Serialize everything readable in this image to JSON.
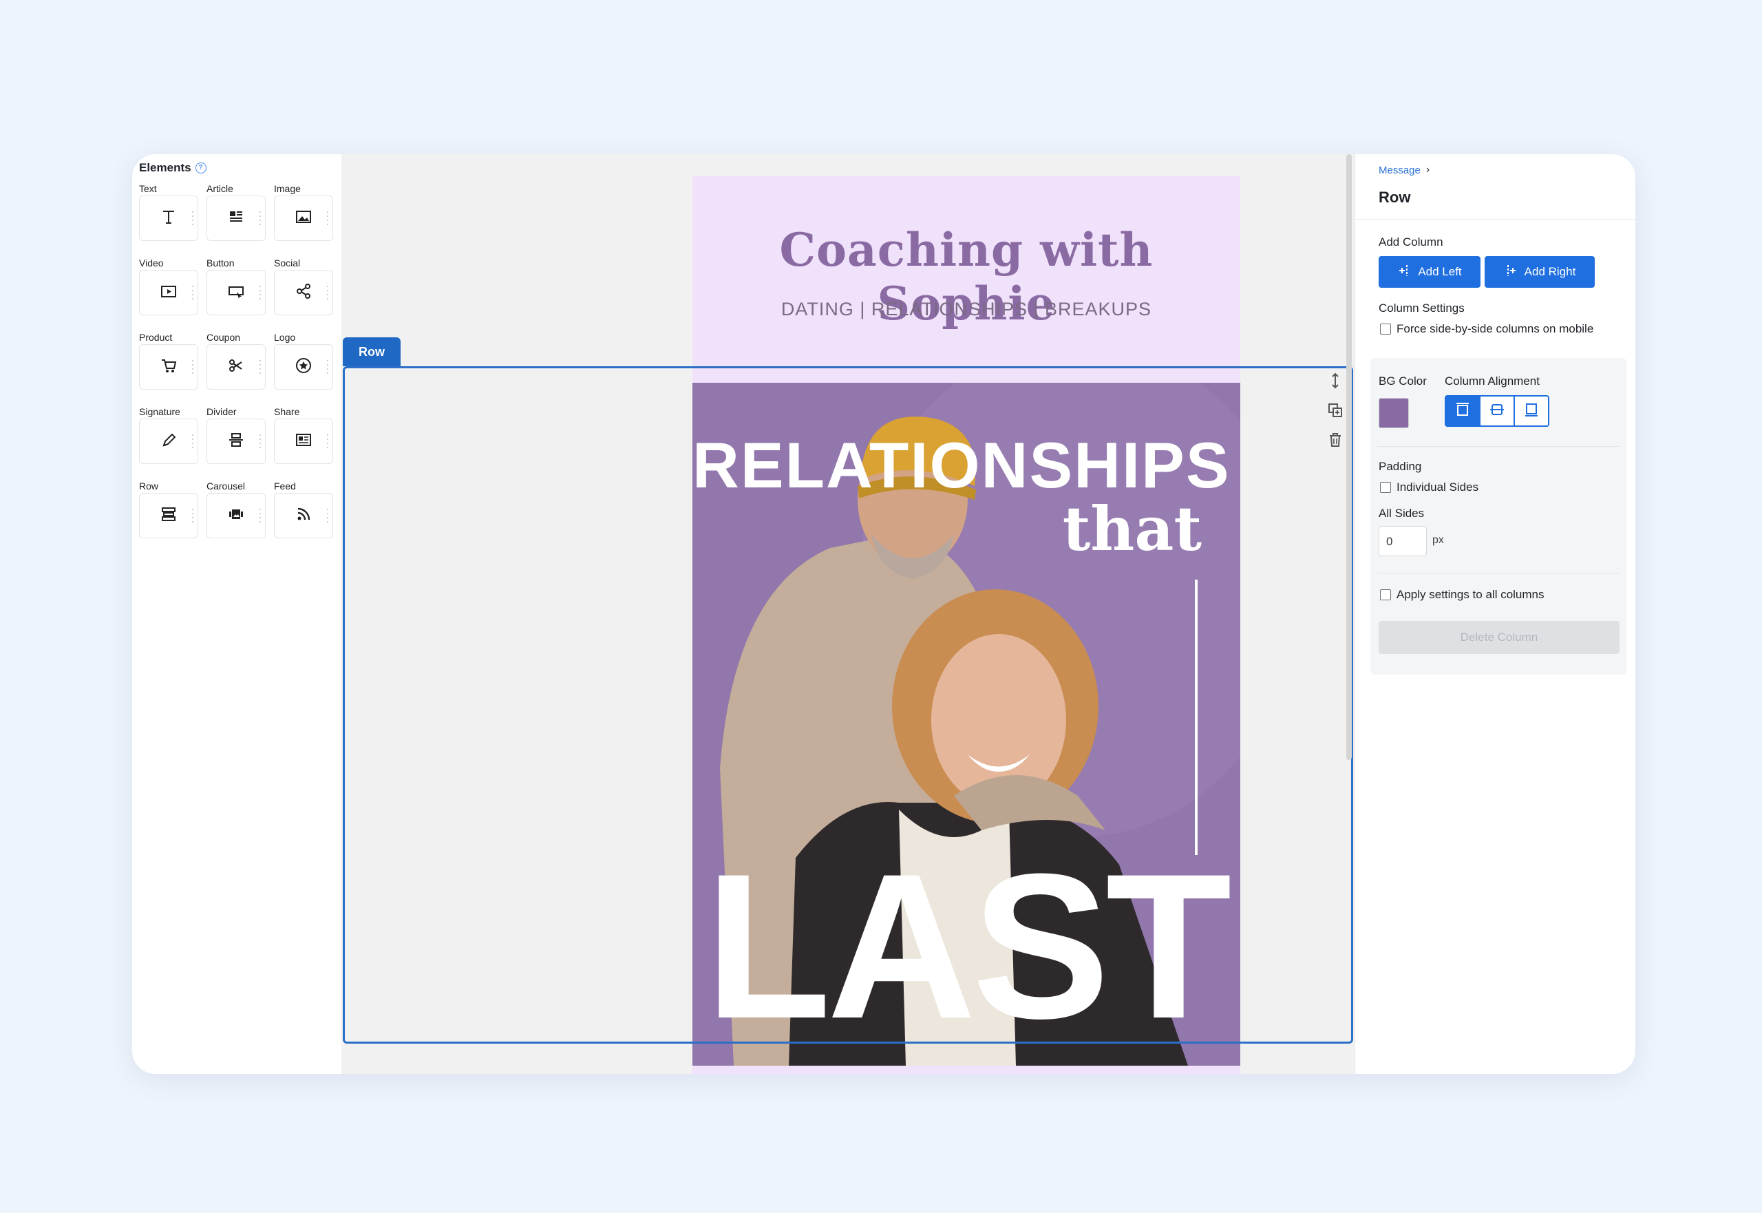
{
  "elements_panel": {
    "title": "Elements",
    "items": [
      {
        "label": "Text",
        "icon": "text-icon"
      },
      {
        "label": "Article",
        "icon": "article-icon"
      },
      {
        "label": "Image",
        "icon": "image-icon"
      },
      {
        "label": "Video",
        "icon": "video-icon"
      },
      {
        "label": "Button",
        "icon": "button-icon"
      },
      {
        "label": "Social",
        "icon": "share-icon"
      },
      {
        "label": "Product",
        "icon": "cart-icon"
      },
      {
        "label": "Coupon",
        "icon": "scissors-icon"
      },
      {
        "label": "Logo",
        "icon": "logo-icon"
      },
      {
        "label": "Signature",
        "icon": "pen-icon"
      },
      {
        "label": "Divider",
        "icon": "divider-icon"
      },
      {
        "label": "Share",
        "icon": "newspaper-icon"
      },
      {
        "label": "Row",
        "icon": "row-icon"
      },
      {
        "label": "Carousel",
        "icon": "carousel-icon"
      },
      {
        "label": "Feed",
        "icon": "rss-icon"
      }
    ]
  },
  "canvas": {
    "row_tag": "Row",
    "email": {
      "header_title": "Coaching with Sophie",
      "header_subtitle": "DATING | RELATIONSHIPS | BREAKUPS",
      "hero_line1": "RELATIONSHIPS",
      "hero_line2": "that",
      "hero_line3": "LAST",
      "header_bg": "#f1e2fb",
      "hero_bg": "#9177ab"
    }
  },
  "settings": {
    "breadcrumb": "Message",
    "title": "Row",
    "add_column_label": "Add Column",
    "add_left": "Add Left",
    "add_right": "Add Right",
    "column_settings_label": "Column Settings",
    "force_side_by_side": "Force side-by-side columns on mobile",
    "bg_color_label": "BG Color",
    "bg_color": "#8a6aa3",
    "column_alignment_label": "Column Alignment",
    "padding_label": "Padding",
    "individual_sides": "Individual Sides",
    "all_sides_label": "All Sides",
    "all_sides_value": "0",
    "unit": "px",
    "apply_all": "Apply settings to all columns",
    "delete_column": "Delete Column",
    "accent": "#1f6fe0"
  }
}
